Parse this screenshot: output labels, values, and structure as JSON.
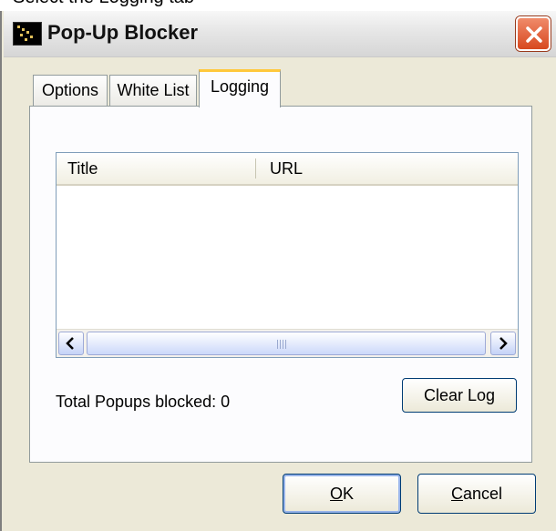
{
  "caption": "Select the Logging tab",
  "window": {
    "title": "Pop-Up Blocker"
  },
  "tabs": [
    {
      "label": "Options",
      "active": false
    },
    {
      "label": "White List",
      "active": false
    },
    {
      "label": "Logging",
      "active": true
    }
  ],
  "log_list": {
    "columns": [
      "Title",
      "URL"
    ],
    "rows": []
  },
  "status": "Total Popups blocked: 0",
  "buttons": {
    "clear_log": "Clear Log",
    "ok_mnemonic": "O",
    "ok_rest": "K",
    "cancel_mnemonic": "C",
    "cancel_rest": "ancel"
  },
  "colors": {
    "active_tab_accent": "#ffc83c",
    "close_button": "#d7481f",
    "dialog_bg": "#ece9d8"
  },
  "icons": [
    "app-icon",
    "close-icon",
    "scroll-left-icon",
    "scroll-right-icon"
  ]
}
